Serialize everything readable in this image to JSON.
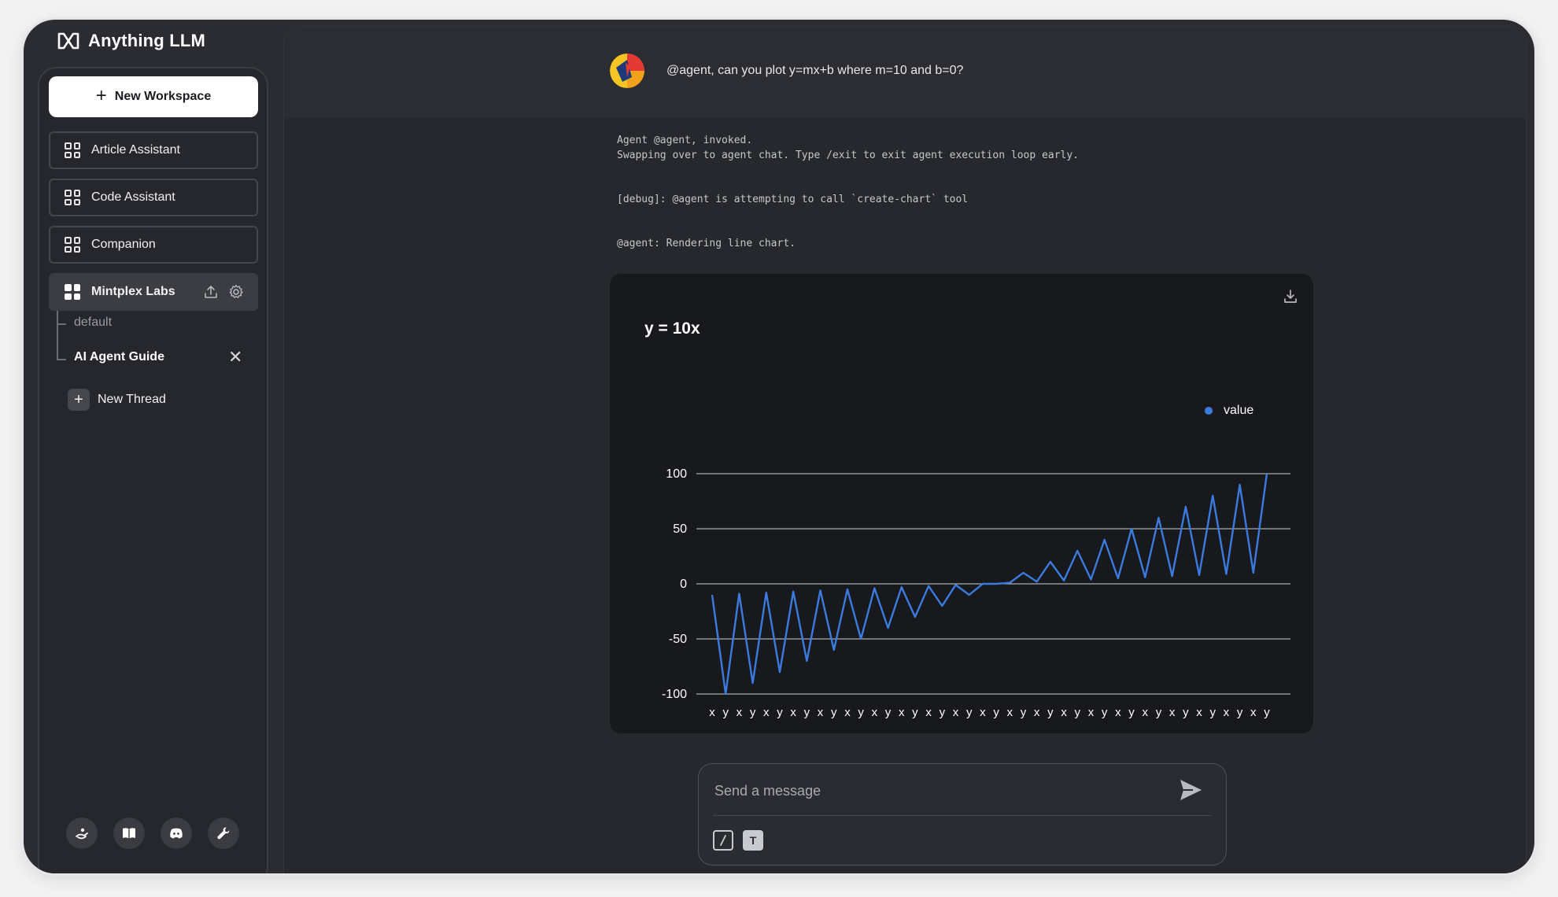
{
  "app": {
    "name": "Anything LLM"
  },
  "sidebar": {
    "new_workspace_label": "New Workspace",
    "workspaces": [
      {
        "label": "Article Assistant"
      },
      {
        "label": "Code Assistant"
      },
      {
        "label": "Companion"
      },
      {
        "label": "Mintplex Labs",
        "active": true
      }
    ],
    "threads": [
      {
        "label": "default",
        "active": false
      },
      {
        "label": "AI Agent Guide",
        "active": true
      }
    ],
    "new_thread_label": "New Thread",
    "footer_icons": [
      "community-hub-icon",
      "docs-book-icon",
      "discord-icon",
      "settings-wrench-icon"
    ]
  },
  "chat": {
    "user_message": "@agent, can you plot y=mx+b where m=10 and b=0?",
    "log_lines": [
      "Agent @agent, invoked.\nSwapping over to agent chat. Type /exit to exit agent execution loop early.",
      "[debug]: @agent is attempting to call `create-chart` tool",
      "@agent: Rendering line chart."
    ]
  },
  "composer": {
    "placeholder": "Send a message"
  },
  "colors": {
    "accent": "#3b7be0",
    "chart_bg": "#18191c"
  },
  "chart_data": {
    "type": "line",
    "title": "y = 10x",
    "legend": [
      "value"
    ],
    "legend_position": "top-right",
    "ylim": [
      -100,
      100
    ],
    "y_ticks": [
      100,
      50,
      0,
      -50,
      -100
    ],
    "grid": true,
    "categories": [
      "x",
      "y",
      "x",
      "y",
      "x",
      "y",
      "x",
      "y",
      "x",
      "y",
      "x",
      "y",
      "x",
      "y",
      "x",
      "y",
      "x",
      "y",
      "x",
      "y",
      "x",
      "y",
      "x",
      "y",
      "x",
      "y",
      "x",
      "y",
      "x",
      "y",
      "x",
      "y",
      "x",
      "y",
      "x",
      "y",
      "x",
      "y",
      "x",
      "y",
      "x",
      "y"
    ],
    "series": [
      {
        "name": "value",
        "values": [
          -10,
          -100,
          -9,
          -90,
          -8,
          -80,
          -7,
          -70,
          -6,
          -60,
          -5,
          -50,
          -4,
          -40,
          -3,
          -30,
          -2,
          -20,
          -1,
          -10,
          0,
          0,
          1,
          10,
          2,
          20,
          3,
          30,
          4,
          40,
          5,
          50,
          6,
          60,
          7,
          70,
          8,
          80,
          9,
          90,
          10,
          100
        ]
      }
    ]
  }
}
